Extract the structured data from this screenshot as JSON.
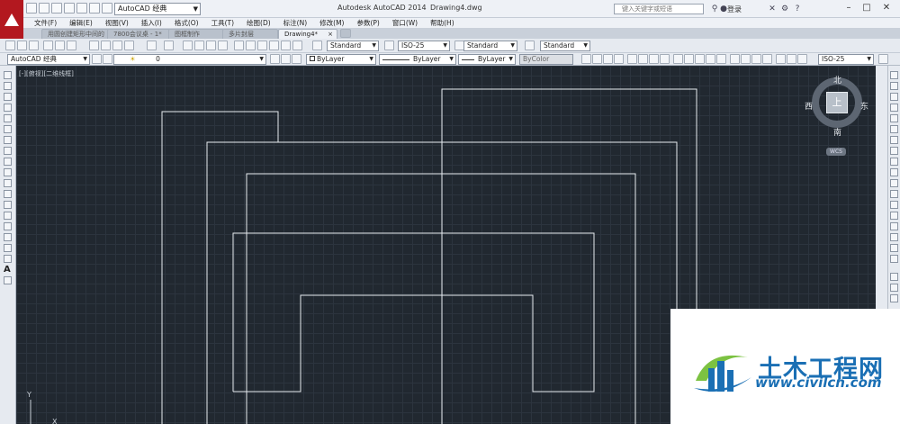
{
  "window": {
    "app_title": "Autodesk AutoCAD 2014",
    "doc_title": "Drawing4.dwg",
    "workspace": "AutoCAD 经典",
    "search_placeholder": "键入关键字或短语",
    "login": "登录"
  },
  "menu": [
    "文件(F)",
    "编辑(E)",
    "视图(V)",
    "插入(I)",
    "格式(O)",
    "工具(T)",
    "绘图(D)",
    "标注(N)",
    "修改(M)",
    "参数(P)",
    "窗口(W)",
    "帮助(H)"
  ],
  "tabs": [
    {
      "label": "用圆创建矩形中间的描边矩形",
      "active": false
    },
    {
      "label": "7800会议桌 - 1*",
      "active": false
    },
    {
      "label": "图框制作",
      "active": false
    },
    {
      "label": "多片封层",
      "active": false
    },
    {
      "label": "Drawing4*",
      "active": true
    }
  ],
  "styles": {
    "text_style": "Standard",
    "dim_style": "ISO-25",
    "table_style": "Standard",
    "multileader_style": "Standard"
  },
  "properties": {
    "workspace_combo": "AutoCAD 经典",
    "layer": "0",
    "color": "ByLayer",
    "linetype": "ByLayer",
    "lineweight": "ByLayer",
    "plotstyle": "ByColor",
    "dim_style": "ISO-25"
  },
  "viewport": {
    "label": "[-][俯视][二维线框]"
  },
  "viewcube": {
    "north": "北",
    "south": "南",
    "east": "东",
    "west": "西",
    "top": "上",
    "wcs": "WCS"
  },
  "ucs": {
    "y": "Y",
    "x": "X"
  },
  "watermark": {
    "title": "土木工程网",
    "url": "www.civilcn.com"
  },
  "colors": {
    "canvas": "#212830",
    "lines": "#e8ecf0",
    "brand_red": "#b3181f",
    "watermark_blue": "#1a6fb4"
  }
}
